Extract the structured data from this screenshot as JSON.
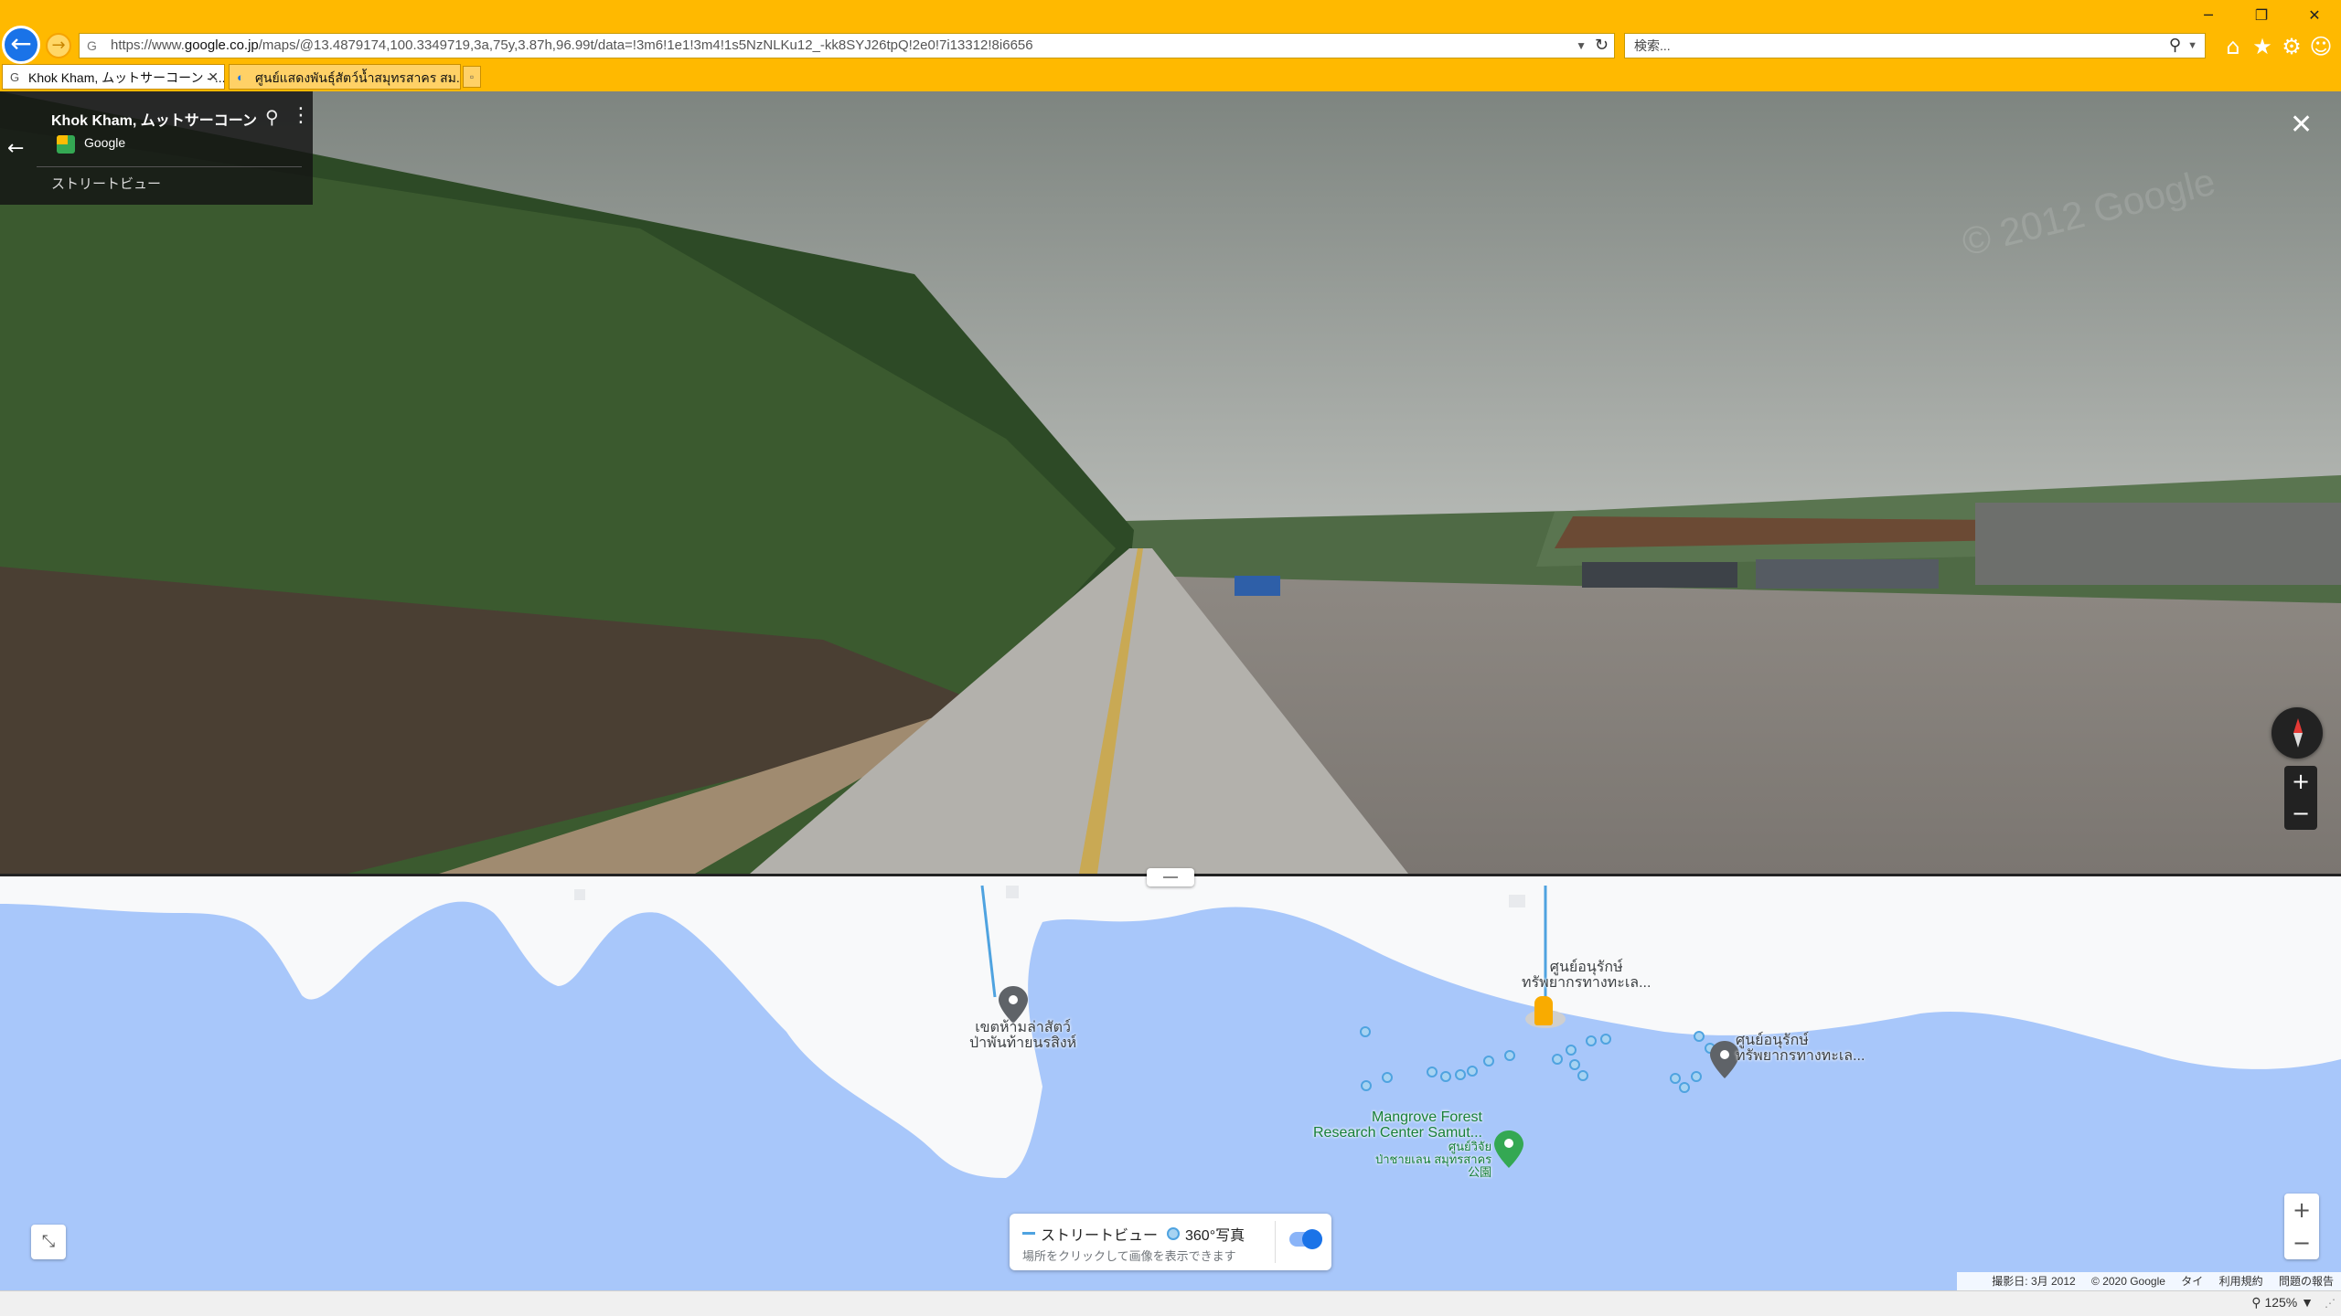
{
  "browser": {
    "url_prefix": "https://www.",
    "url_domain": "google.co.jp",
    "url_rest": "/maps/@13.4879174,100.3349719,3a,75y,3.87h,96.99t/data=!3m6!1e1!3m4!1s5NzNLKu12_-kk8SYJ26tpQ!2e0!7i13312!8i6656",
    "search_placeholder": "検索...",
    "tabs": [
      {
        "label": "Khok Kham, ムットサーコーン - ...",
        "active": true
      },
      {
        "label": "ศูนย์แสดงพันธุ์สัตว์น้ำสมุทรสาคร สม...",
        "active": false
      }
    ],
    "zoom_level": "125%"
  },
  "streetview": {
    "title": "Khok Kham, ムットサーコーン",
    "provider": "Google",
    "mode_label": "ストリートビュー"
  },
  "map": {
    "labels": {
      "reserve_line1": "เขตห้ามล่าสัตว์",
      "reserve_line2": "ป่าพันท้ายนรสิงห์",
      "center1_line1": "ศูนย์อนุรักษ์",
      "center1_line2": "ทรัพยากรทางทะเล...",
      "center2_line1": "ศูนย์อนุรักษ์",
      "center2_line2": "ทรัพยากรทางทะเล...",
      "mangrove_line1": "Mangrove Forest",
      "mangrove_line2": "Research Center Samut...",
      "park_line1": "ศูนย์วิจัย",
      "park_line2": "ป่าชายเลน สมุทรสาคร",
      "park_line3": "公園"
    },
    "legend": {
      "streetview": "ストリートビュー",
      "photo360": "360°写真",
      "hint": "場所をクリックして画像を表示できます"
    },
    "attribution": {
      "date": "撮影日: 3月 2012",
      "copyright": "© 2020 Google",
      "country": "タイ",
      "terms": "利用規約",
      "report": "問題の報告"
    }
  },
  "icons": {
    "back": "arrow-left-icon",
    "forward": "arrow-right-icon",
    "refresh": "refresh-icon",
    "home": "home-icon",
    "star": "star-icon",
    "gear": "gear-icon",
    "smiley": "smiley-icon"
  },
  "colors": {
    "browser_chrome": "#ffb900",
    "water": "#a8c7fa",
    "land": "#f8f9fa",
    "coverage": "#4fa3e0",
    "accent": "#1a73e8"
  }
}
